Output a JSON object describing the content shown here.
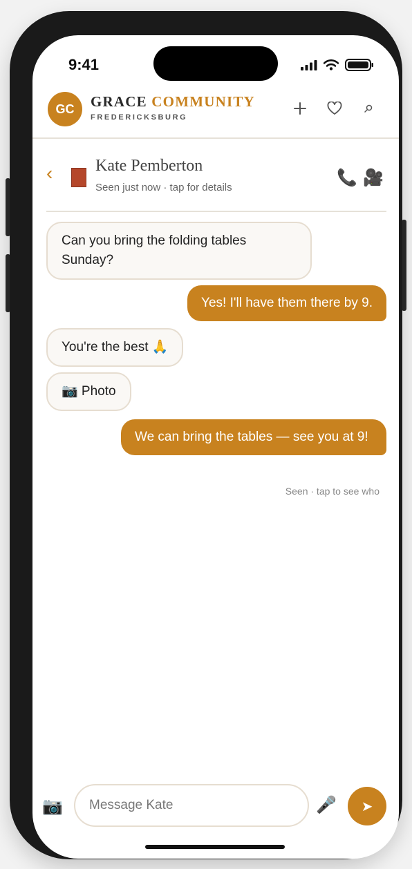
{
  "status_bar": {
    "time": "9:41"
  },
  "app": {
    "logo_initials": "GC",
    "brand_primary": "GRACE",
    "brand_accent": "COMMUNITY",
    "location": "FREDERICKSBURG",
    "accent_color": "#c8821f",
    "header_icons": [
      "plus-icon",
      "heart-icon",
      "search-icon"
    ]
  },
  "chat": {
    "back_glyph": "‹",
    "contact_name": "Kate Pemberton",
    "contact_status": "Seen just now · tap for details",
    "call_glyph": "📞",
    "video_glyph": "🎥"
  },
  "messages": [
    {
      "direction": "incoming",
      "text": "Can you bring the folding tables Sunday?"
    },
    {
      "direction": "outgoing",
      "text": "Yes! I'll have them there by 9."
    },
    {
      "direction": "incoming",
      "text": "You're the best 🙏"
    },
    {
      "direction": "incoming",
      "text": "📷 Photo"
    },
    {
      "direction": "outgoing",
      "text": "We can bring the tables — see you at 9!"
    }
  ],
  "seen_receipt": "Seen · tap to see who",
  "composer": {
    "camera_glyph": "📷",
    "placeholder": "Message Kate",
    "mic_glyph": "🎤",
    "send_glyph": "➤"
  }
}
